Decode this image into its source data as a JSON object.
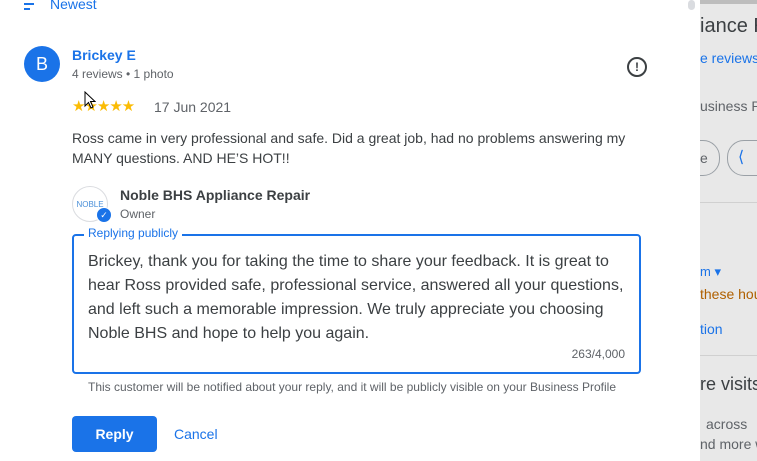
{
  "sort": {
    "label": "Newest"
  },
  "review": {
    "avatar_letter": "B",
    "name": "Brickey E",
    "meta": "4 reviews • 1 photo",
    "stars": "★★★★★",
    "rating": 5,
    "date": "17 Jun 2021",
    "text": "Ross came in very professional and safe. Did a great job, had no problems answering my MANY questions. AND HE’S HOT!!"
  },
  "owner": {
    "logo_text": "NOBLE",
    "name": "Noble BHS Appliance Repair",
    "role": "Owner"
  },
  "reply": {
    "legend": "Replying publicly",
    "text": "Brickey, thank you for taking the time to share your feedback. It is great to hear Ross provided safe, professional service, answered all your questions, and left such a memorable impression. We truly appreciate you choosing Noble BHS and hope to help you again.",
    "char_count": "263/4,000",
    "notice": "This customer will be notified about your reply, and it will be publicly visible on your Business Profile",
    "reply_label": "Reply",
    "cancel_label": "Cancel"
  },
  "background_panel": {
    "title_fragment": "iance R",
    "reviews_link": "e reviews",
    "business_text": "usiness P",
    "share_fragment": "e",
    "m_fragment": "m ▾",
    "hours_fragment": "these hou",
    "tion_fragment": "tion",
    "visits_fragment": "re visits",
    "across_fragment": "across",
    "more_fragment": "nd more w"
  },
  "colors": {
    "accent": "#1a73e8",
    "star": "#fbbc04",
    "warning": "#b06000"
  }
}
